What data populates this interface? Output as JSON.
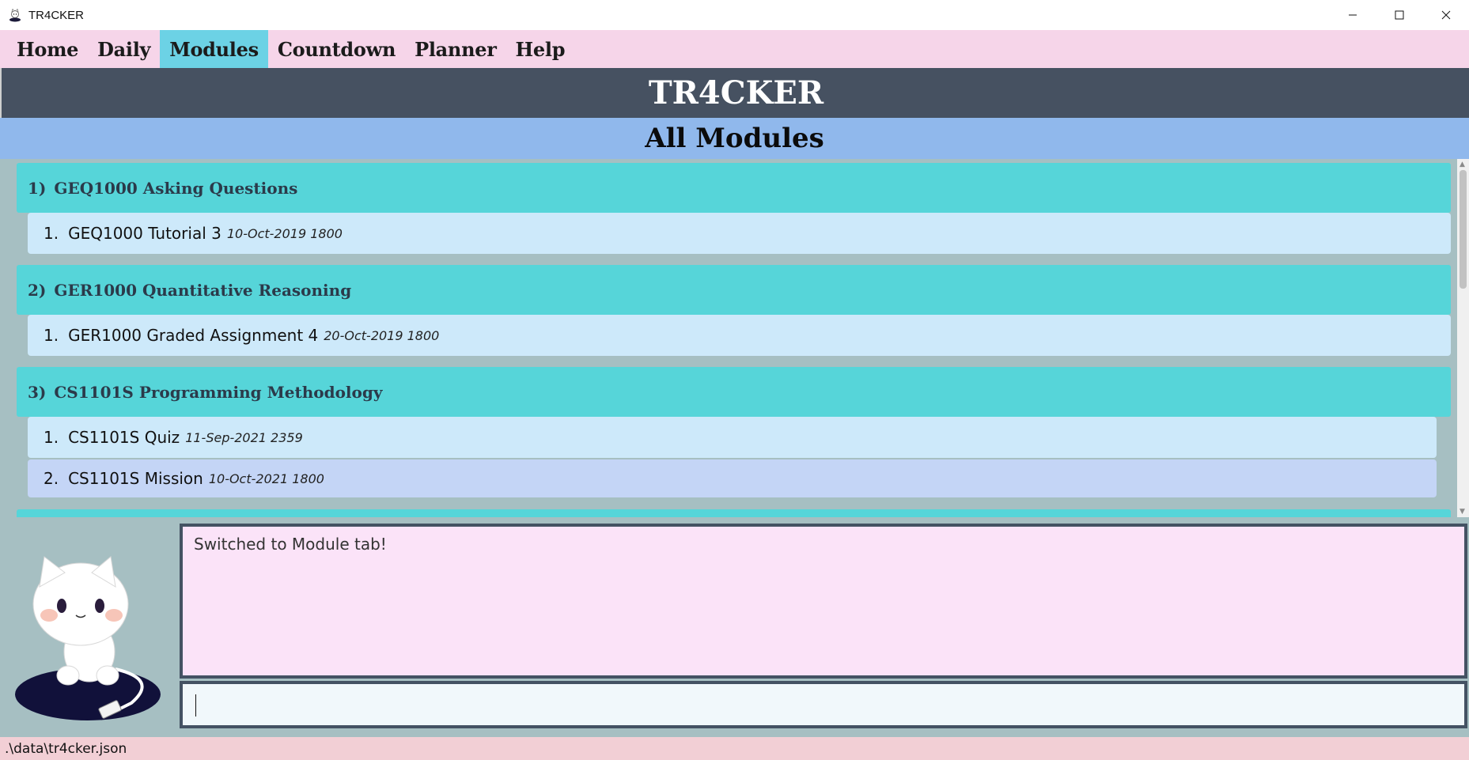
{
  "window": {
    "title": "TR4CKER",
    "controls": [
      "minimize",
      "maximize",
      "close"
    ]
  },
  "menu": {
    "items": [
      {
        "label": "Home",
        "active": false
      },
      {
        "label": "Daily",
        "active": false
      },
      {
        "label": "Modules",
        "active": true
      },
      {
        "label": "Countdown",
        "active": false
      },
      {
        "label": "Planner",
        "active": false
      },
      {
        "label": "Help",
        "active": false
      }
    ]
  },
  "header": {
    "title": "TR4CKER",
    "subtitle": "All Modules"
  },
  "modules": [
    {
      "index": "1)",
      "name": "GEQ1000 Asking Questions",
      "tasks": [
        {
          "num": "1.",
          "name": "GEQ1000 Tutorial 3",
          "date": "10-Oct-2019 1800"
        }
      ]
    },
    {
      "index": "2)",
      "name": "GER1000 Quantitative Reasoning",
      "tasks": [
        {
          "num": "1.",
          "name": "GER1000 Graded Assignment 4",
          "date": "20-Oct-2019 1800"
        }
      ]
    },
    {
      "index": "3)",
      "name": "CS1101S Programming Methodology",
      "tasks": [
        {
          "num": "1.",
          "name": "CS1101S Quiz",
          "date": "11-Sep-2021 2359"
        },
        {
          "num": "2.",
          "name": "CS1101S Mission",
          "date": "10-Oct-2021 1800"
        }
      ]
    }
  ],
  "result": {
    "message": "Switched to Module tab!"
  },
  "command": {
    "value": ""
  },
  "status": {
    "file_path": ".\\data\\tr4cker.json"
  },
  "colors": {
    "menu_bg": "#f6d5e9",
    "menu_active": "#6cd2e5",
    "header_bg": "#465161",
    "subheader_bg": "#90b8ec",
    "list_bg": "#a6bfc2",
    "module_header": "#56d5d9",
    "task_light": "#cde9fa",
    "task_selected": "#c4d5f6",
    "result_bg": "#fbe3f8",
    "command_bg": "#f1f8fb",
    "status_bg": "#f2cfd5"
  }
}
